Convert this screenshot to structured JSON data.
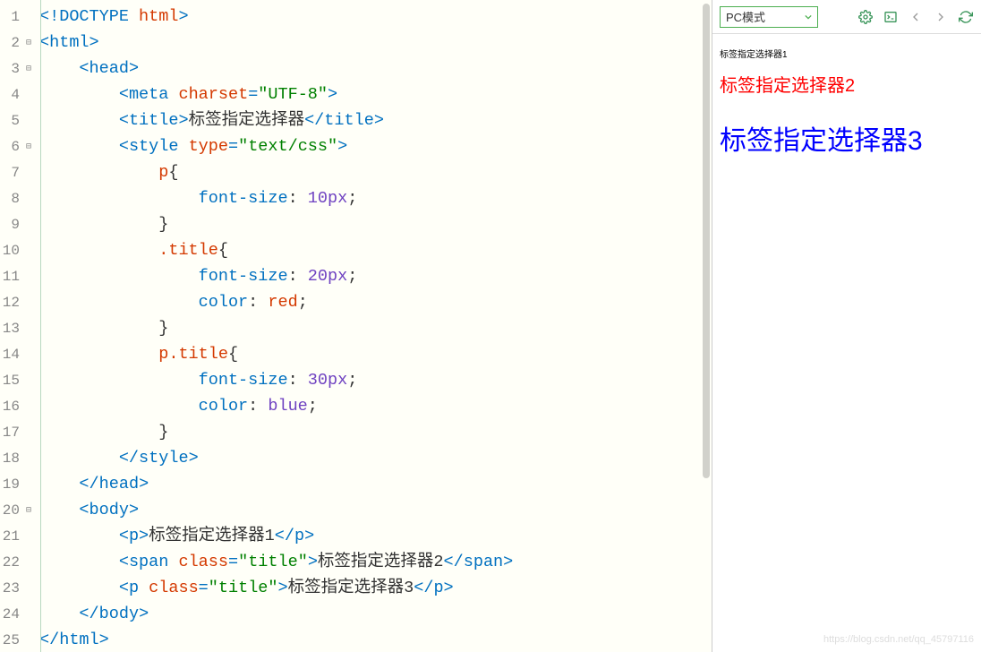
{
  "toolbar": {
    "mode": "PC模式"
  },
  "preview": {
    "p1": "标签指定选择器1",
    "p2": "标签指定选择器2",
    "p3": "标签指定选择器3"
  },
  "watermark": "https://blog.csdn.net/qq_45797116",
  "code": {
    "lines": [
      {
        "n": 1,
        "fold": "",
        "html": "<span class='punct'>&lt;!</span><span class='tag'>DOCTYPE</span><span class='text'> </span><span class='attr'>html</span><span class='punct'>&gt;</span>"
      },
      {
        "n": 2,
        "fold": "⊟",
        "html": "<span class='punct'>&lt;</span><span class='tag'>html</span><span class='punct'>&gt;</span>"
      },
      {
        "n": 3,
        "fold": "⊟",
        "html": "    <span class='punct'>&lt;</span><span class='tag'>head</span><span class='punct'>&gt;</span>"
      },
      {
        "n": 4,
        "fold": "",
        "html": "        <span class='punct'>&lt;</span><span class='tag'>meta</span> <span class='attr'>charset</span><span class='punct'>=</span><span class='value'>\"UTF-8\"</span><span class='punct'>&gt;</span>"
      },
      {
        "n": 5,
        "fold": "",
        "html": "        <span class='punct'>&lt;</span><span class='tag'>title</span><span class='punct'>&gt;</span><span class='text'>标签指定选择器</span><span class='punct'>&lt;/</span><span class='tag'>title</span><span class='punct'>&gt;</span>"
      },
      {
        "n": 6,
        "fold": "⊟",
        "html": "        <span class='punct'>&lt;</span><span class='tag'>style</span> <span class='attr'>type</span><span class='punct'>=</span><span class='value'>\"text/css\"</span><span class='punct'>&gt;</span>"
      },
      {
        "n": 7,
        "fold": "",
        "html": "            <span class='selector'>p</span><span class='text'>{</span>"
      },
      {
        "n": 8,
        "fold": "",
        "html": "                <span class='cssprop'>font-size</span><span class='text'>: </span><span class='cssval'>10px</span><span class='text'>;</span>"
      },
      {
        "n": 9,
        "fold": "",
        "html": "            <span class='text'>}</span>"
      },
      {
        "n": 10,
        "fold": "",
        "html": "            <span class='selector'>.title</span><span class='text'>{</span>"
      },
      {
        "n": 11,
        "fold": "",
        "html": "                <span class='cssprop'>font-size</span><span class='text'>: </span><span class='cssval'>20px</span><span class='text'>;</span>"
      },
      {
        "n": 12,
        "fold": "",
        "html": "                <span class='cssprop'>color</span><span class='text'>: </span><span class='cssred'>red</span><span class='text'>;</span>"
      },
      {
        "n": 13,
        "fold": "",
        "html": "            <span class='text'>}</span>"
      },
      {
        "n": 14,
        "fold": "",
        "html": "            <span class='selector'>p.title</span><span class='text'>{</span>"
      },
      {
        "n": 15,
        "fold": "",
        "html": "                <span class='cssprop'>font-size</span><span class='text'>: </span><span class='cssval'>30px</span><span class='text'>;</span>"
      },
      {
        "n": 16,
        "fold": "",
        "html": "                <span class='cssprop'>color</span><span class='text'>: </span><span class='cssblue'>blue</span><span class='text'>;</span>"
      },
      {
        "n": 17,
        "fold": "",
        "html": "            <span class='text'>}</span>"
      },
      {
        "n": 18,
        "fold": "",
        "html": "        <span class='punct'>&lt;/</span><span class='tag'>style</span><span class='punct'>&gt;</span>"
      },
      {
        "n": 19,
        "fold": "",
        "html": "    <span class='punct'>&lt;/</span><span class='tag'>head</span><span class='punct'>&gt;</span>"
      },
      {
        "n": 20,
        "fold": "⊟",
        "html": "    <span class='punct'>&lt;</span><span class='tag'>body</span><span class='punct'>&gt;</span>"
      },
      {
        "n": 21,
        "fold": "",
        "html": "        <span class='punct'>&lt;</span><span class='tag'>p</span><span class='punct'>&gt;</span><span class='text'>标签指定选择器1</span><span class='punct'>&lt;/</span><span class='tag'>p</span><span class='punct'>&gt;</span>"
      },
      {
        "n": 22,
        "fold": "",
        "html": "        <span class='punct'>&lt;</span><span class='tag'>span</span> <span class='attr'>class</span><span class='punct'>=</span><span class='value'>\"title\"</span><span class='punct'>&gt;</span><span class='text'>标签指定选择器2</span><span class='punct'>&lt;/</span><span class='tag'>span</span><span class='punct'>&gt;</span>"
      },
      {
        "n": 23,
        "fold": "",
        "html": "        <span class='punct'>&lt;</span><span class='tag'>p</span> <span class='attr'>class</span><span class='punct'>=</span><span class='value'>\"title\"</span><span class='punct'>&gt;</span><span class='text'>标签指定选择器3</span><span class='punct'>&lt;/</span><span class='tag'>p</span><span class='punct'>&gt;</span>"
      },
      {
        "n": 24,
        "fold": "",
        "html": "    <span class='punct'>&lt;/</span><span class='tag'>body</span><span class='punct'>&gt;</span>"
      },
      {
        "n": 25,
        "fold": "",
        "html": "<span class='punct'>&lt;/</span><span class='tag'>html</span><span class='punct'>&gt;</span>"
      }
    ]
  }
}
